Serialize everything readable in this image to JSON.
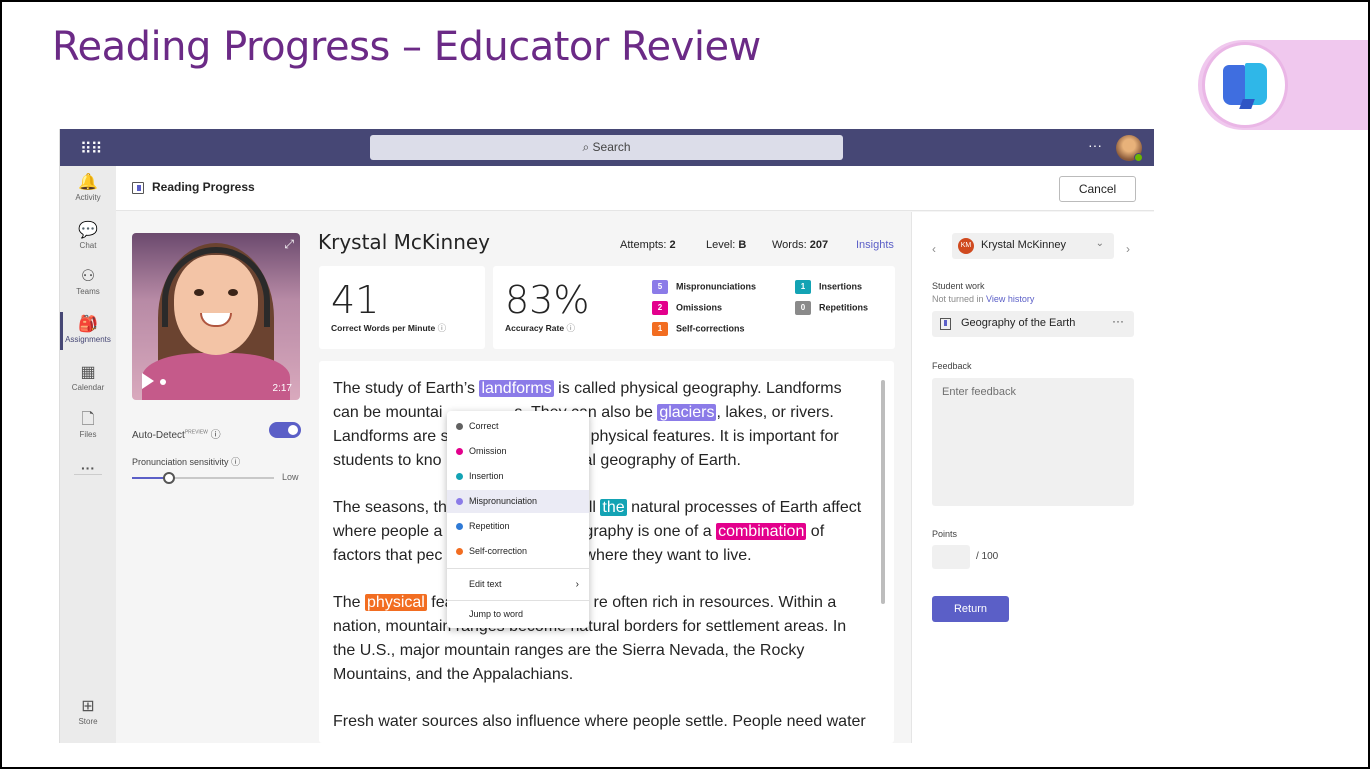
{
  "slide": {
    "title": "Reading Progress – Educator Review"
  },
  "topbar": {
    "search_placeholder": "Search",
    "more": "···"
  },
  "rail": {
    "items": [
      {
        "label": "Activity",
        "icon": "bell-icon",
        "glyph": "🔔"
      },
      {
        "label": "Chat",
        "icon": "chat-icon",
        "glyph": "💬"
      },
      {
        "label": "Teams",
        "icon": "teams-icon",
        "glyph": "⚇"
      },
      {
        "label": "Assignments",
        "icon": "backpack-icon",
        "glyph": "🎒"
      },
      {
        "label": "Calendar",
        "icon": "calendar-icon",
        "glyph": "▦"
      },
      {
        "label": "Files",
        "icon": "file-icon",
        "glyph": "🗋"
      },
      {
        "label": "···",
        "icon": "more-icon",
        "glyph": ""
      },
      {
        "label": "Store",
        "icon": "store-icon",
        "glyph": "⊞"
      }
    ]
  },
  "header": {
    "title": "Reading Progress",
    "cancel": "Cancel"
  },
  "video": {
    "time": "2:17",
    "expand": "⤢"
  },
  "controls": {
    "auto_detect": "Auto-Detect",
    "preview": "PREVIEW",
    "info": "ⓘ",
    "auto_detect_on": true,
    "pronunciation_sensitivity": "Pronunciation sensitivity",
    "sensitivity_level": "Low",
    "sensitivity_fraction": 0.25
  },
  "student": {
    "name": "Krystal McKinney",
    "attempts_label": "Attempts:",
    "attempts": "2",
    "level_label": "Level:",
    "level": "B",
    "words_label": "Words:",
    "words": "207",
    "insights": "Insights"
  },
  "stats": {
    "wcpm": "41",
    "wcpm_label": "Correct Words per Minute",
    "accuracy": "83%",
    "accuracy_label": "Accuracy Rate",
    "errors": [
      {
        "count": "5",
        "label": "Mispronunciations",
        "color": "#8b7be8"
      },
      {
        "count": "2",
        "label": "Omissions",
        "color": "#e3008c"
      },
      {
        "count": "1",
        "label": "Self-corrections",
        "color": "#f26d21"
      },
      {
        "count": "1",
        "label": "Insertions",
        "color": "#13a3b4"
      },
      {
        "count": "0",
        "label": "Repetitions",
        "color": "#8a8a8a"
      }
    ]
  },
  "passage": {
    "l1a": "The study of Earth’s ",
    "l1h": "landforms",
    "l1b": " is called physical geography. Landforms",
    "l2a": "can be mountai",
    "l2b": "s. They can also be ",
    "l2h": "glaciers",
    "l2c": ", lakes, or rivers.",
    "l3a": "Landforms are s",
    "l3b": "physical features. It is important for",
    "l4a": "students to kno",
    "l4b": "al geography of Earth.",
    "l5a": "The seasons, th",
    "l5b": "ll ",
    "l5h": "the",
    "l5c": " natural processes of Earth affect",
    "l6a": "where people a",
    "l6b": "graphy is one of a ",
    "l6h": "combination",
    "l6c": " of",
    "l7a": "factors that pec",
    "l7b": "where they want to live.",
    "l8a": "The ",
    "l8h": "physical",
    "l8b": " fea",
    "l8c": "re often rich in resources. Within a",
    "l9": "nation, mountain ranges become natural borders for settlement areas. In",
    "l10": "the U.S., major mountain ranges are the Sierra Nevada, the Rocky",
    "l11": "Mountains, and the Appalachians.",
    "l12": "Fresh water sources also influence where people settle. People need water"
  },
  "menu": {
    "items": [
      {
        "label": "Correct",
        "color": "#616161"
      },
      {
        "label": "Omission",
        "color": "#e3008c"
      },
      {
        "label": "Insertion",
        "color": "#13a3b4"
      },
      {
        "label": "Mispronunciation",
        "color": "#8b7be8"
      },
      {
        "label": "Repetition",
        "color": "#2f7ad6"
      },
      {
        "label": "Self-correction",
        "color": "#f26d21"
      }
    ],
    "edit_text": "Edit text",
    "jump_to_word": "Jump to word"
  },
  "right_panel": {
    "initials": "KM",
    "student_name": "Krystal McKinney",
    "student_work_label": "Student work",
    "not_turned_in": "Not turned in",
    "view_history": "View history",
    "work_item": "Geography of the Earth",
    "feedback_label": "Feedback",
    "feedback_placeholder": "Enter feedback",
    "points_label": "Points",
    "points_of": "/ 100",
    "return_button": "Return"
  }
}
